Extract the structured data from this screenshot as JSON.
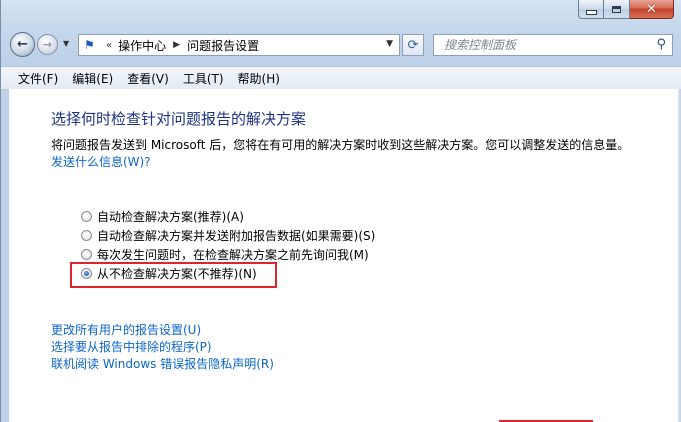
{
  "window": {
    "caption_buttons": {
      "minimize": "minimize",
      "maximize": "maximize",
      "close": "✕"
    }
  },
  "nav": {
    "breadcrumb": {
      "overflow": "«",
      "items": [
        "操作中心",
        "问题报告设置"
      ]
    },
    "search_placeholder": "搜索控制面板"
  },
  "menubar": {
    "items": [
      "文件(F)",
      "编辑(E)",
      "查看(V)",
      "工具(T)",
      "帮助(H)"
    ]
  },
  "main": {
    "heading": "选择何时检查针对问题报告的解决方案",
    "description": "将问题报告发送到 Microsoft 后，您将在有可用的解决方案时收到这些解决方案。您可以调整发送的信息量。",
    "info_link": "发送什么信息(W)?",
    "options": [
      {
        "label": "自动检查解决方案(推荐)(A)",
        "checked": false
      },
      {
        "label": "自动检查解决方案并发送附加报告数据(如果需要)(S)",
        "checked": false
      },
      {
        "label": "每次发生问题时，在检查解决方案之前先询问我(M)",
        "checked": false
      },
      {
        "label": "从不检查解决方案(不推荐)(N)",
        "checked": true
      }
    ],
    "links": [
      "更改所有用户的报告设置(U)",
      "选择要从报告中排除的程序(P)",
      "联机阅读 Windows 错误报告隐私声明(R)"
    ]
  },
  "colors": {
    "heading": "#1e3287",
    "link": "#0b66c9",
    "highlight": "#e0242c"
  }
}
